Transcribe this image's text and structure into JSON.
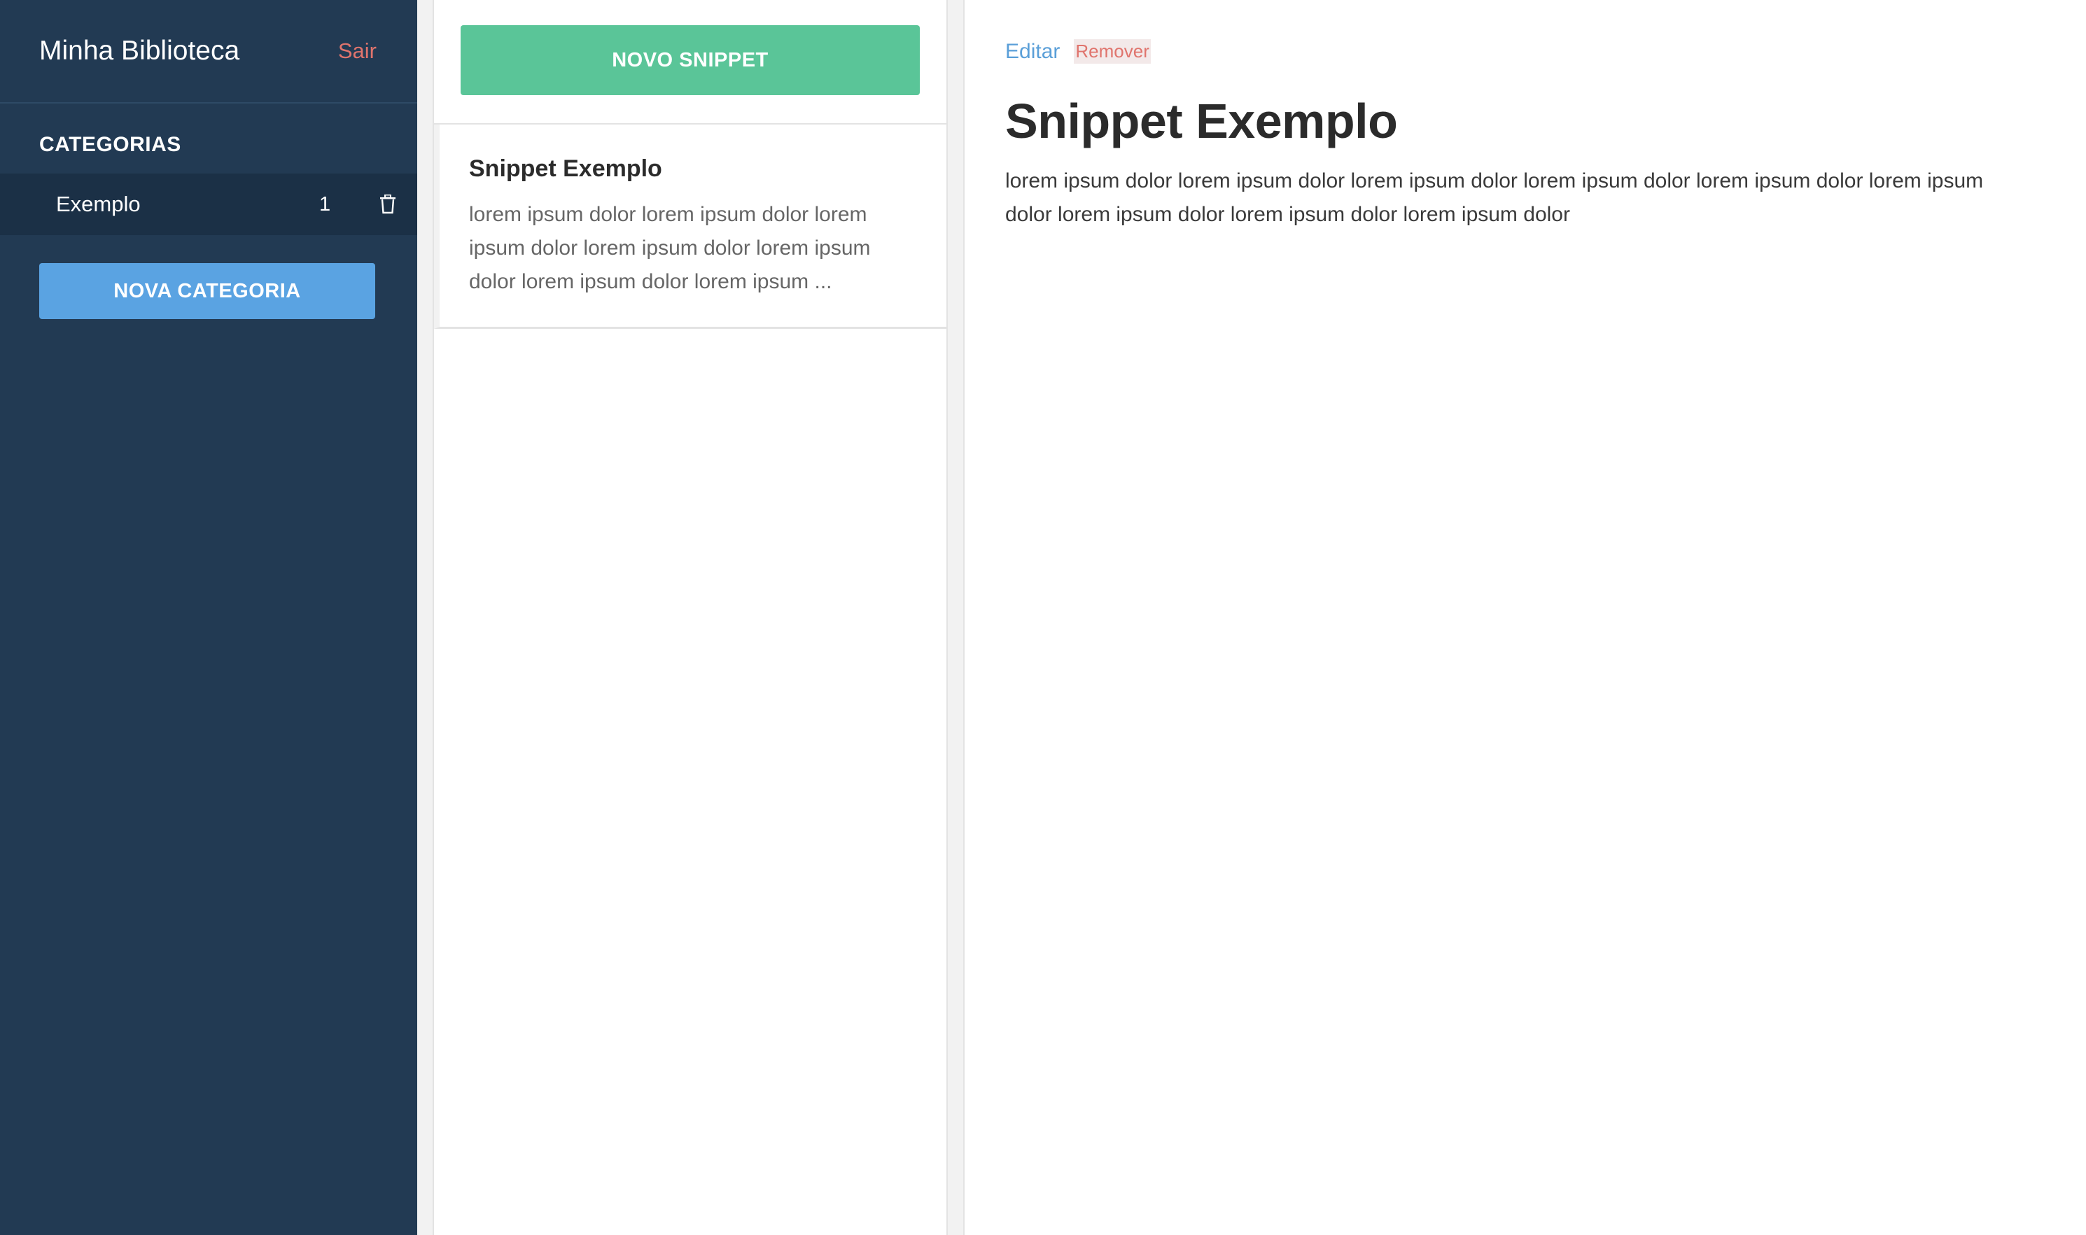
{
  "sidebar": {
    "title": "Minha Biblioteca",
    "logout_label": "Sair",
    "categories_heading": "CATEGORIAS",
    "categories": [
      {
        "name": "Exemplo",
        "count": "1"
      }
    ],
    "new_category_label": "NOVA CATEGORIA"
  },
  "snippets": {
    "new_snippet_label": "NOVO SNIPPET",
    "items": [
      {
        "title": "Snippet Exemplo",
        "excerpt": "lorem ipsum dolor lorem ipsum dolor lorem ipsum dolor lorem ipsum dolor lorem ipsum dolor lorem ipsum dolor lorem ipsum ..."
      }
    ]
  },
  "detail": {
    "edit_label": "Editar",
    "remove_label": "Remover",
    "title": "Snippet Exemplo",
    "body": "lorem ipsum dolor lorem ipsum dolor lorem ipsum dolor lorem ipsum dolor lorem ipsum dolor lorem ipsum dolor lorem ipsum dolor lorem ipsum dolor lorem ipsum dolor"
  },
  "colors": {
    "sidebar_bg": "#223a53",
    "category_active_bg": "#1b3046",
    "new_category_button": "#5aa3e2",
    "new_snippet_button": "#5ac598",
    "logout": "#e0746d",
    "edit_link": "#5a9fd8",
    "remove_link": "#e0746d"
  },
  "icons": {
    "delete_category": "trash-icon"
  }
}
